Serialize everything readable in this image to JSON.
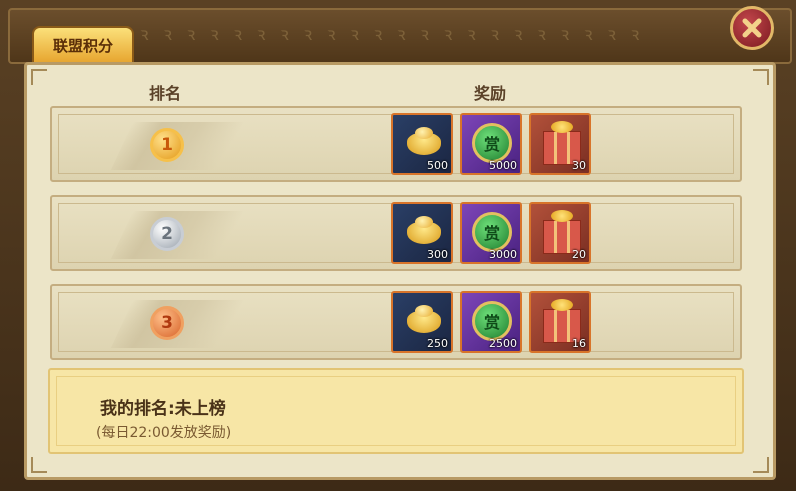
{
  "tab": {
    "title": "联盟积分"
  },
  "header": {
    "rank_label": "排名",
    "reward_label": "奖励"
  },
  "decor_pattern": "ꝛ ꝛ ꝛ ꝛ ꝛ ꝛ ꝛ ꝛ ꝛ ꝛ ꝛ ꝛ ꝛ ꝛ ꝛ ꝛ ꝛ ꝛ ꝛ ꝛ ꝛ ꝛ",
  "close_icon": "close-x-icon",
  "rows": [
    {
      "rank": "1",
      "medal": "gold-medal-icon",
      "rewards": [
        {
          "icon": "gold-ingot-icon",
          "qty": "500"
        },
        {
          "icon": "reward-coin-icon",
          "qty": "5000"
        },
        {
          "icon": "gift-box-icon",
          "qty": "30"
        }
      ]
    },
    {
      "rank": "2",
      "medal": "silver-medal-icon",
      "rewards": [
        {
          "icon": "gold-ingot-icon",
          "qty": "300"
        },
        {
          "icon": "reward-coin-icon",
          "qty": "3000"
        },
        {
          "icon": "gift-box-icon",
          "qty": "20"
        }
      ]
    },
    {
      "rank": "3",
      "medal": "bronze-medal-icon",
      "rewards": [
        {
          "icon": "gold-ingot-icon",
          "qty": "250"
        },
        {
          "icon": "reward-coin-icon",
          "qty": "2500"
        },
        {
          "icon": "gift-box-icon",
          "qty": "16"
        }
      ]
    }
  ],
  "coin_glyph": "赏",
  "my_rank": {
    "text": "我的排名:未上榜",
    "note": "(每日22:00发放奖励)"
  },
  "colors": {
    "gold": "#e39a1a",
    "silver": "#9aa3ad",
    "bronze": "#d8642a",
    "close": "#7a1a1f"
  }
}
